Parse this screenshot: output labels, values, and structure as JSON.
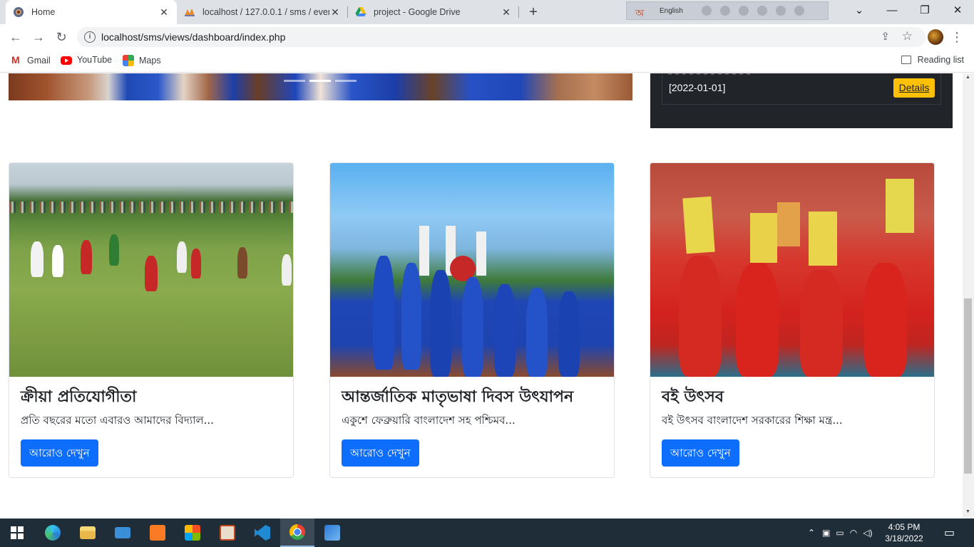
{
  "browser": {
    "tabs": [
      {
        "title": "Home",
        "active": true
      },
      {
        "title": "localhost / 127.0.0.1 / sms / even",
        "active": false
      },
      {
        "title": "project - Google Drive",
        "active": false
      }
    ],
    "ime_label": "English",
    "url": "localhost/sms/views/dashboard/index.php",
    "bookmarks": [
      "Gmail",
      "YouTube",
      "Maps"
    ],
    "reading_list": "Reading list"
  },
  "notice": {
    "date": "[2022-01-01]",
    "details_label": "Details"
  },
  "cards": [
    {
      "title": "ক্রীয়া প্রতিযোগীতা",
      "text": "প্রতি বছরের মতো এবারও আমাদের বিদ্যাল...",
      "button": "আরোও দেখুন"
    },
    {
      "title": "আন্তর্জাতিক মাতৃভাষা দিবস উৎযাপন",
      "text": "একুশে ফেব্রুয়ারি বাংলাদেশ সহ পশ্চিমব...",
      "button": "আরোও দেখুন"
    },
    {
      "title": "বই উৎসব",
      "text": "বই উৎসব বাংলাদেশ সরকারের শিক্ষা মন্ত্র...",
      "button": "আরোও দেখুন"
    }
  ],
  "taskbar": {
    "time": "4:05 PM",
    "date": "3/18/2022"
  }
}
